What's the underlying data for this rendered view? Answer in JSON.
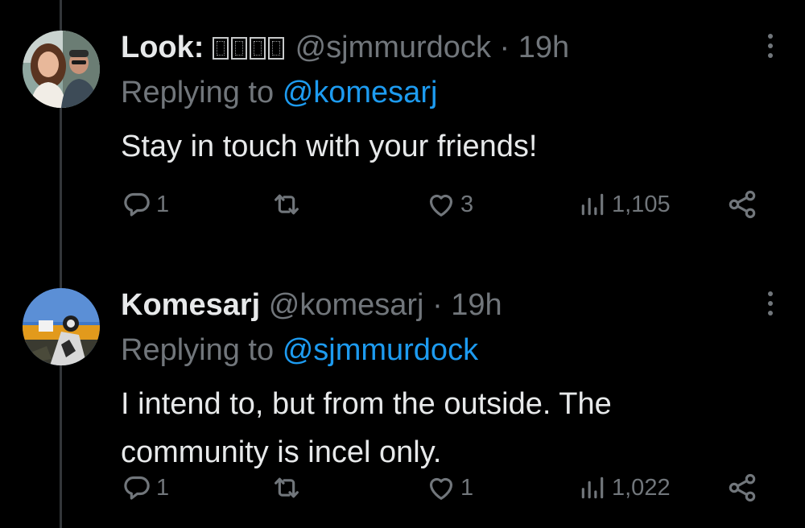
{
  "tweets": [
    {
      "display_name": "Look:",
      "handle": "@sjmmurdock",
      "separator": "·",
      "time": "19h",
      "replying_prefix": "Replying to",
      "replying_to": "@komesarj",
      "text": "Stay in touch with your friends!",
      "replies": "1",
      "retweets": "",
      "likes": "3",
      "views": "1,105"
    },
    {
      "display_name": "Komesarj",
      "handle": "@komesarj",
      "separator": "·",
      "time": "19h",
      "replying_prefix": "Replying to",
      "replying_to": "@sjmmurdock",
      "text": "I intend to, but from the outside. The community is incel only.",
      "replies": "1",
      "retweets": "",
      "likes": "1",
      "views": "1,022"
    }
  ],
  "icons": {
    "reply": "reply-icon",
    "retweet": "retweet-icon",
    "like": "heart-icon",
    "views": "views-chart-icon",
    "share": "share-icon",
    "more": "more-icon"
  },
  "colors": {
    "background": "#000000",
    "primary_text": "#e7e9ea",
    "muted_text": "#71767b",
    "link": "#1d9bf0",
    "thread_line": "#333639"
  }
}
